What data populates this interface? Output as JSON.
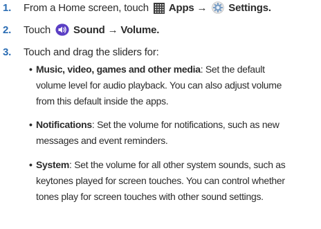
{
  "steps": [
    {
      "number": "1.",
      "pre": "From a Home screen, touch",
      "apps_label": "Apps",
      "arrow": "→",
      "settings_label": "Settings",
      "end": ".",
      "icons": [
        "apps-grid-icon",
        "settings-gear-icon"
      ]
    },
    {
      "number": "2.",
      "pre": "Touch",
      "sound_label": "Sound",
      "arrow": "→",
      "volume_label": "Volume",
      "end": ".",
      "icons": [
        "sound-speaker-icon"
      ]
    },
    {
      "number": "3.",
      "text": "Touch and drag the sliders for:"
    }
  ],
  "bullets": [
    {
      "bullet": "•",
      "term": "Music, video, games and other media",
      "lines": [
        ": Set the default",
        "volume level for audio playback. You can also adjust volume",
        "from this default inside the apps."
      ]
    },
    {
      "bullet": "•",
      "term": "Notifications",
      "lines": [
        ": Set the volume for notifications, such as new",
        "messages and event reminders."
      ]
    },
    {
      "bullet": "•",
      "term": "System",
      "lines": [
        ": Set the volume for all other system sounds, such as",
        "keytones played for screen touches. You can control whether",
        "tones play for screen touches with other sound settings."
      ]
    }
  ],
  "colors": {
    "step_number": "#2a6cb3",
    "text": "#2b2b2b",
    "sound_icon": "#5b3fc4"
  }
}
